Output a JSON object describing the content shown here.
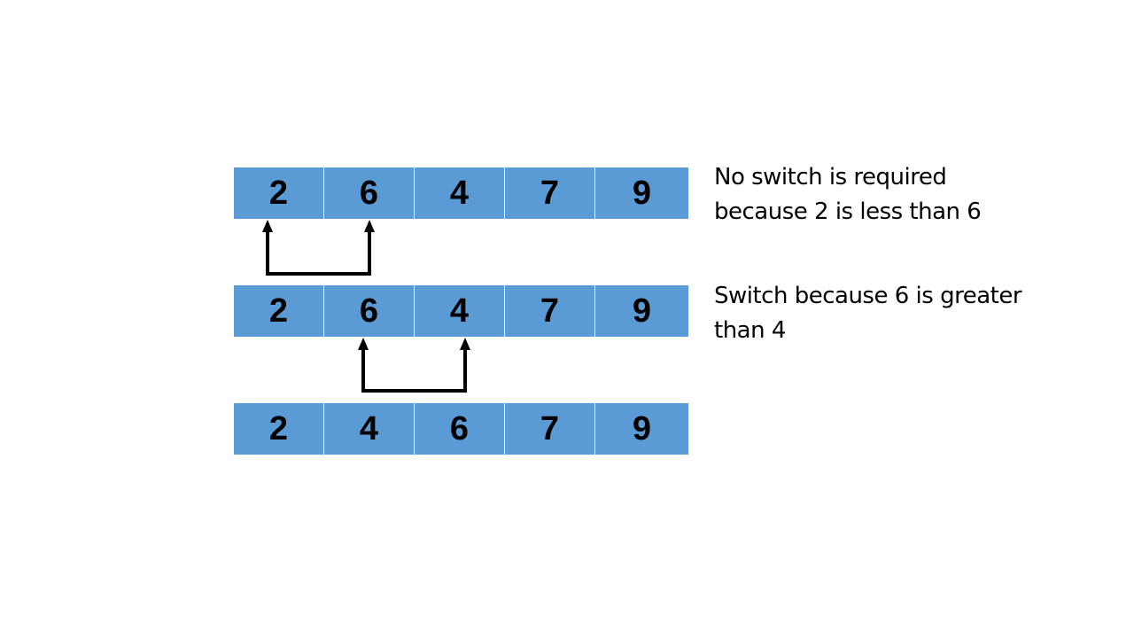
{
  "colors": {
    "cell_fill": "#5b9bd5",
    "text": "#000000",
    "background": "#ffffff"
  },
  "rows": [
    {
      "values": [
        "2",
        "6",
        "4",
        "7",
        "9"
      ],
      "note_lines": [
        "No switch is required",
        "because 2 is less than 6"
      ]
    },
    {
      "values": [
        "2",
        "6",
        "4",
        "7",
        "9"
      ],
      "note_lines": [
        "Switch because 6 is greater",
        "than 4"
      ]
    },
    {
      "values": [
        "2",
        "4",
        "6",
        "7",
        "9"
      ],
      "note_lines": []
    }
  ],
  "comparisons": [
    {
      "row": 0,
      "from_index": 0,
      "to_index": 1,
      "swap": false
    },
    {
      "row": 1,
      "from_index": 1,
      "to_index": 2,
      "swap": true
    }
  ]
}
